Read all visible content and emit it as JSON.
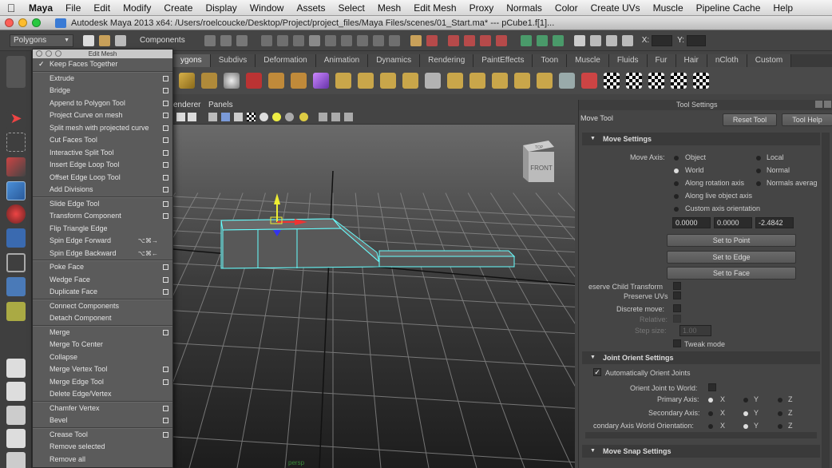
{
  "menubar": {
    "apple_icon": "apple-icon",
    "items": [
      "Maya",
      "File",
      "Edit",
      "Modify",
      "Create",
      "Display",
      "Window",
      "Assets",
      "Select",
      "Mesh",
      "Edit Mesh",
      "Proxy",
      "Normals",
      "Color",
      "Create UVs",
      "Muscle",
      "Pipeline Cache",
      "Help"
    ]
  },
  "titlebar": {
    "title": "Autodesk Maya 2013 x64: /Users/roelcoucke/Desktop/Project/project_files/Maya Files/scenes/01_Start.ma*   ---   pCube1.f[1]..."
  },
  "statusline": {
    "menuset": "Polygons",
    "components_label": "Components",
    "x_label": "X:",
    "y_label": "Y:"
  },
  "shelf": {
    "tabs": [
      "ygons",
      "Subdivs",
      "Deformation",
      "Animation",
      "Dynamics",
      "Rendering",
      "PaintEffects",
      "Toon",
      "Muscle",
      "Fluids",
      "Fur",
      "Hair",
      "nCloth",
      "Custom"
    ],
    "active_tab": "ygons"
  },
  "menu": {
    "title": "Edit Mesh",
    "sections": [
      [
        {
          "label": "Keep Faces Together",
          "checked": true
        }
      ],
      [
        {
          "label": "Extrude",
          "option": true
        },
        {
          "label": "Bridge",
          "option": true
        },
        {
          "label": "Append to Polygon Tool",
          "option": true
        },
        {
          "label": "Project Curve on mesh",
          "option": true
        },
        {
          "label": "Split mesh with projected curve",
          "option": true
        },
        {
          "label": "Cut Faces Tool",
          "option": true
        },
        {
          "label": "Interactive Split Tool",
          "option": true
        },
        {
          "label": "Insert Edge Loop Tool",
          "option": true
        },
        {
          "label": "Offset Edge Loop Tool",
          "option": true
        },
        {
          "label": "Add Divisions",
          "option": true
        }
      ],
      [
        {
          "label": "Slide Edge Tool",
          "option": true
        },
        {
          "label": "Transform Component",
          "option": true
        },
        {
          "label": "Flip Triangle Edge"
        },
        {
          "label": "Spin Edge Forward",
          "shortcut": "⌥⌘→"
        },
        {
          "label": "Spin Edge Backward",
          "shortcut": "⌥⌘←"
        }
      ],
      [
        {
          "label": "Poke Face",
          "option": true
        },
        {
          "label": "Wedge Face",
          "option": true
        },
        {
          "label": "Duplicate Face",
          "option": true
        }
      ],
      [
        {
          "label": "Connect Components"
        },
        {
          "label": "Detach Component"
        }
      ],
      [
        {
          "label": "Merge",
          "option": true
        },
        {
          "label": "Merge To Center"
        },
        {
          "label": "Collapse"
        },
        {
          "label": "Merge Vertex Tool",
          "option": true
        },
        {
          "label": "Merge Edge Tool",
          "option": true
        },
        {
          "label": "Delete Edge/Vertex"
        }
      ],
      [
        {
          "label": "Chamfer Vertex",
          "option": true
        },
        {
          "label": "Bevel",
          "option": true
        }
      ],
      [
        {
          "label": "Crease Tool",
          "option": true
        },
        {
          "label": "Remove selected"
        },
        {
          "label": "Remove all"
        }
      ]
    ]
  },
  "viewport": {
    "menu": [
      "enderer",
      "Panels"
    ],
    "viewcube_top": "TOP",
    "viewcube_front": "FRONT",
    "camera_label": "persp"
  },
  "tool_settings": {
    "panel_title": "Tool Settings",
    "tool_name": "Move Tool",
    "reset_button": "Reset Tool",
    "help_button": "Tool Help",
    "move_settings": {
      "header": "Move Settings",
      "move_axis_label": "Move Axis:",
      "options": [
        "Object",
        "Local",
        "World",
        "Normal",
        "Along rotation axis",
        "Normals averag",
        "Along live object axis",
        "Custom axis orientation"
      ],
      "selected": "World",
      "values": [
        "0.0000",
        "0.0000",
        "-2.4842"
      ],
      "set_to_point": "Set to Point",
      "set_to_edge": "Set to Edge",
      "set_to_face": "Set to Face",
      "preserve_child": "eserve Child Transform",
      "preserve_uvs": "Preserve UVs",
      "discrete_move": "Discrete move:",
      "relative": "Relative:",
      "step_size": "Step size:",
      "step_value": "1.00",
      "tweak_mode": "Tweak mode"
    },
    "joint_orient": {
      "header": "Joint Orient Settings",
      "auto_orient": "Automatically Orient Joints",
      "orient_to_world": "Orient Joint to World:",
      "primary_axis": "Primary Axis:",
      "secondary_axis": "Secondary Axis:",
      "secondary_world": "condary Axis World Orientation:",
      "axes": [
        "X",
        "Y",
        "Z"
      ]
    },
    "move_snap": {
      "header": "Move Snap Settings"
    }
  }
}
